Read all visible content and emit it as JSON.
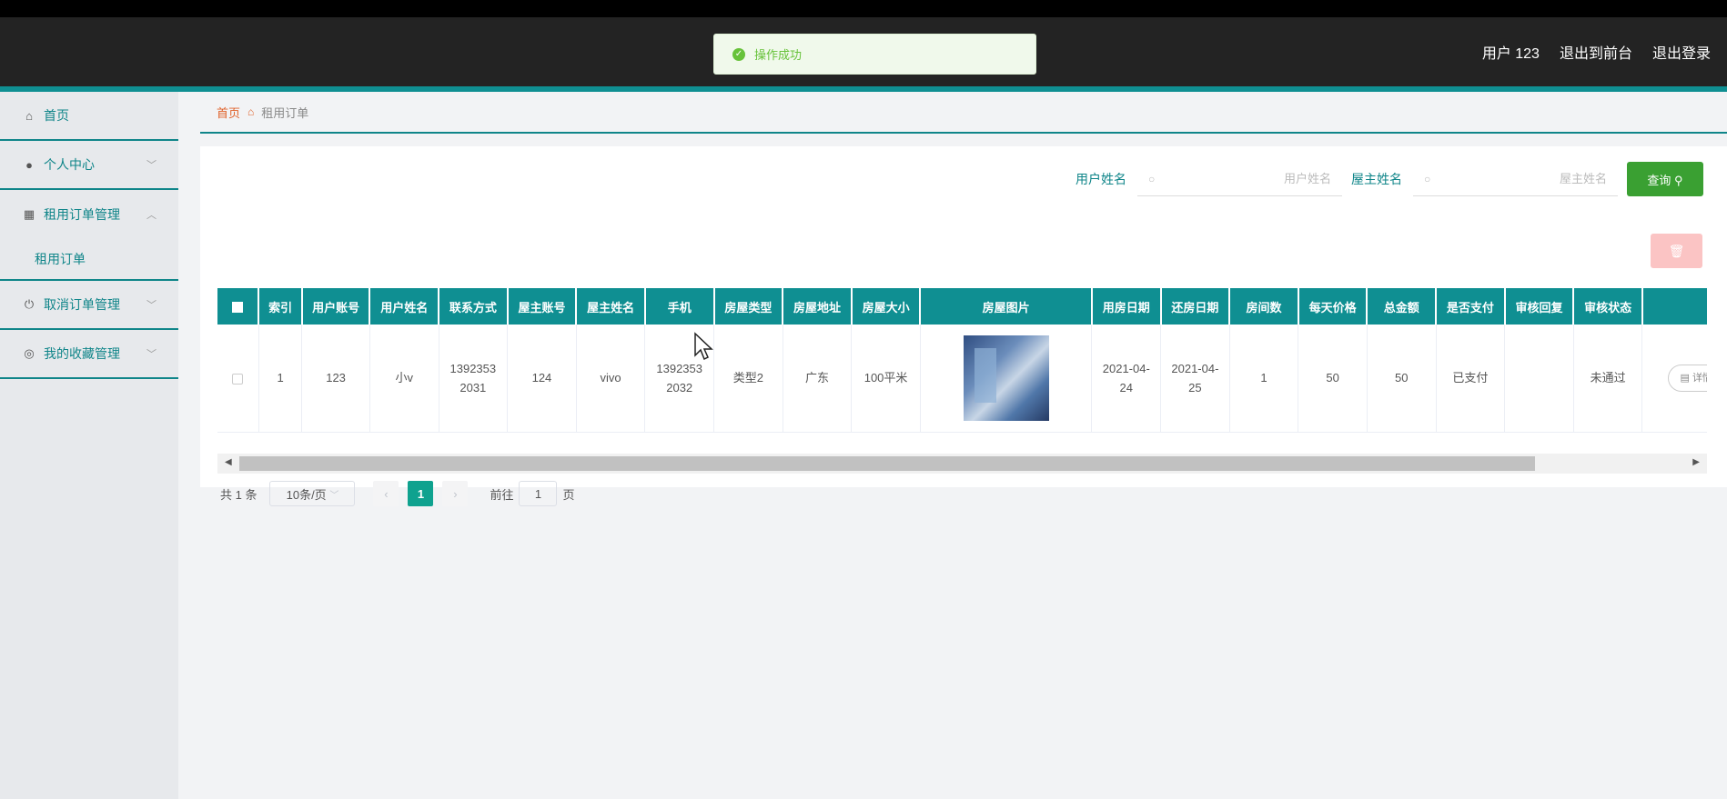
{
  "toast": {
    "text": "操作成功",
    "icon": "check-circle-icon"
  },
  "header": {
    "user": "用户 123",
    "back_to_front": "退出到前台",
    "logout": "退出登录"
  },
  "sidebar": {
    "items": [
      {
        "label": "首页",
        "icon": "home-icon"
      },
      {
        "label": "个人中心",
        "icon": "user-icon"
      },
      {
        "label": "租用订单管理",
        "icon": "grid-icon"
      },
      {
        "label": "取消订单管理",
        "icon": "power-icon"
      },
      {
        "label": "我的收藏管理",
        "icon": "compass-icon"
      }
    ],
    "sub_item": "租用订单"
  },
  "breadcrumb": {
    "home": "首页",
    "current": "租用订单"
  },
  "search": {
    "user_name_label": "用户姓名",
    "user_name_placeholder": "用户姓名",
    "owner_name_label": "屋主姓名",
    "owner_name_placeholder": "屋主姓名",
    "query_label": "查询"
  },
  "table": {
    "headers": [
      "索引",
      "用户账号",
      "用户姓名",
      "联系方式",
      "屋主账号",
      "屋主姓名",
      "手机",
      "房屋类型",
      "房屋地址",
      "房屋大小",
      "房屋图片",
      "用房日期",
      "还房日期",
      "房间数",
      "每天价格",
      "总金额",
      "是否支付",
      "审核回复",
      "审核状态"
    ],
    "rows": [
      {
        "index": "1",
        "user_account": "123",
        "user_name": "小v",
        "contact": "13923532031",
        "owner_account": "124",
        "owner_name": "vivo",
        "phone": "13923532032",
        "house_type": "类型2",
        "address": "广东",
        "size": "100平米",
        "start_date": "2021-04-24",
        "end_date": "2021-04-25",
        "rooms": "1",
        "daily_price": "50",
        "total": "50",
        "paid": "已支付",
        "review_reply": "",
        "review_status": "未通过",
        "detail_label": "详情"
      }
    ]
  },
  "pagination": {
    "total_text": "共 1 条",
    "page_size": "10条/页",
    "current_page": "1",
    "goto_label": "前往",
    "goto_value": "1",
    "page_unit": "页"
  },
  "colors": {
    "primary": "#0f8f92",
    "success": "#3aa032",
    "danger_light": "#fbc4c4",
    "header_bg": "#232323"
  }
}
